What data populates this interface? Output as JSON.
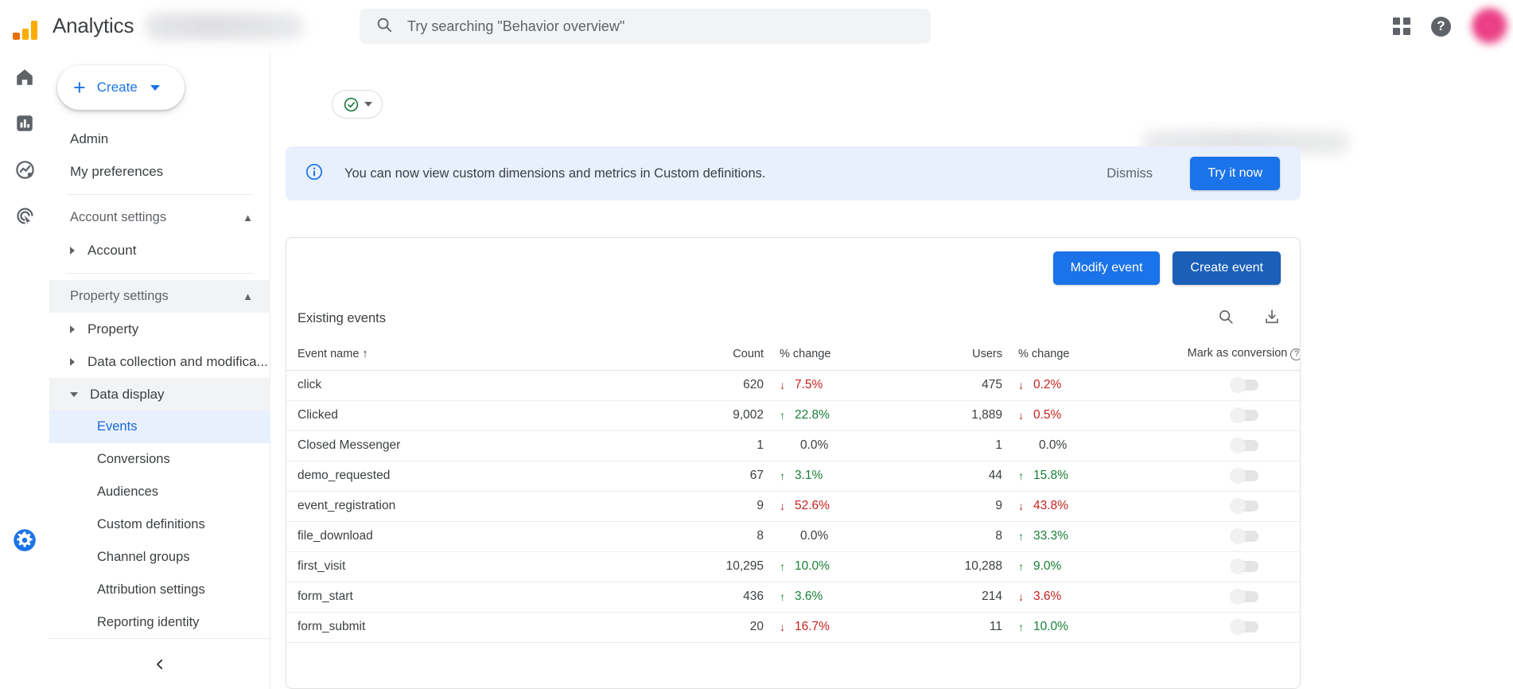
{
  "topbar": {
    "brand": "Analytics",
    "property_redacted": true,
    "search": {
      "placeholder": "Try searching \"Behavior overview\"",
      "value": "",
      "icon": "search-icon"
    },
    "apps_icon": "apps-grid-icon",
    "help_icon": "help-circle-icon",
    "avatar_icon": "user-avatar"
  },
  "rail": {
    "items": [
      {
        "icon": "home-icon",
        "name": "home"
      },
      {
        "icon": "reports-bar-chart-icon",
        "name": "reports"
      },
      {
        "icon": "explore-trend-icon",
        "name": "explore"
      },
      {
        "icon": "advertising-target-icon",
        "name": "advertising"
      }
    ],
    "settings_icon": "gear-icon"
  },
  "nav": {
    "create_label": "Create",
    "create_icon": "plus-icon",
    "create_caret": "chevron-down-icon",
    "items": [
      {
        "label": "Admin",
        "type": "link"
      },
      {
        "label": "My preferences",
        "type": "link"
      },
      {
        "label": "Account settings",
        "type": "group",
        "collapse_icon": "chevron-up-icon"
      },
      {
        "label": "Account",
        "type": "expandable",
        "expand_icon": "triangle-right-icon"
      },
      {
        "label": "Property settings",
        "type": "group",
        "collapse_icon": "chevron-up-icon"
      },
      {
        "label": "Property",
        "type": "expandable",
        "expand_icon": "triangle-right-icon"
      },
      {
        "label": "Data collection and modifica...",
        "type": "expandable",
        "expand_icon": "triangle-right-icon"
      },
      {
        "label": "Data display",
        "type": "expandable-open",
        "expand_icon": "triangle-down-icon"
      },
      {
        "label": "Events",
        "type": "sub",
        "selected": true
      },
      {
        "label": "Conversions",
        "type": "sub",
        "selected": false
      },
      {
        "label": "Audiences",
        "type": "sub",
        "selected": false
      },
      {
        "label": "Custom definitions",
        "type": "sub",
        "selected": false
      },
      {
        "label": "Channel groups",
        "type": "sub",
        "selected": false
      },
      {
        "label": "Attribution settings",
        "type": "sub",
        "selected": false
      },
      {
        "label": "Reporting identity",
        "type": "sub",
        "selected": false
      }
    ],
    "collapse_icon": "chevron-left-icon"
  },
  "main": {
    "status_chip": {
      "icon": "check-circle-icon",
      "caret": "chevron-down-icon",
      "color": "#137333"
    },
    "title_redacted": true,
    "banner": {
      "icon": "info-circle-icon",
      "text": "You can now view custom dimensions and metrics in Custom definitions.",
      "dismiss_label": "Dismiss",
      "cta_label": "Try it now",
      "bg": "#e8f0fe",
      "cta_color": "#1a73e8"
    },
    "actions": {
      "modify_label": "Modify event",
      "create_label": "Create event",
      "modify_color": "#1a73e8",
      "create_color": "#1b5fb8"
    },
    "table": {
      "title": "Existing events",
      "search_icon": "search-icon",
      "download_icon": "download-icon",
      "columns": [
        {
          "label": "Event name",
          "sort_icon": "arrow-up-icon"
        },
        {
          "label": "Count"
        },
        {
          "label": "% change"
        },
        {
          "label": "Users"
        },
        {
          "label": "% change"
        },
        {
          "label": "Mark as conversion",
          "help_icon": "help-circle-small-icon"
        }
      ],
      "rows": [
        {
          "event": "click",
          "count": "620",
          "count_dir": "down",
          "count_pct": "7.5%",
          "users": "475",
          "users_dir": "down",
          "users_pct": "0.2%",
          "conversion": false
        },
        {
          "event": "Clicked",
          "count": "9,002",
          "count_dir": "up",
          "count_pct": "22.8%",
          "users": "1,889",
          "users_dir": "down",
          "users_pct": "0.5%",
          "conversion": false
        },
        {
          "event": "Closed Messenger",
          "count": "1",
          "count_dir": "flat",
          "count_pct": "0.0%",
          "users": "1",
          "users_dir": "flat",
          "users_pct": "0.0%",
          "conversion": false
        },
        {
          "event": "demo_requested",
          "count": "67",
          "count_dir": "up",
          "count_pct": "3.1%",
          "users": "44",
          "users_dir": "up",
          "users_pct": "15.8%",
          "conversion": false
        },
        {
          "event": "event_registration",
          "count": "9",
          "count_dir": "down",
          "count_pct": "52.6%",
          "users": "9",
          "users_dir": "down",
          "users_pct": "43.8%",
          "conversion": false
        },
        {
          "event": "file_download",
          "count": "8",
          "count_dir": "flat",
          "count_pct": "0.0%",
          "users": "8",
          "users_dir": "up",
          "users_pct": "33.3%",
          "conversion": false
        },
        {
          "event": "first_visit",
          "count": "10,295",
          "count_dir": "up",
          "count_pct": "10.0%",
          "users": "10,288",
          "users_dir": "up",
          "users_pct": "9.0%",
          "conversion": false
        },
        {
          "event": "form_start",
          "count": "436",
          "count_dir": "up",
          "count_pct": "3.6%",
          "users": "214",
          "users_dir": "down",
          "users_pct": "3.6%",
          "conversion": false
        },
        {
          "event": "form_submit",
          "count": "20",
          "count_dir": "down",
          "count_pct": "16.7%",
          "users": "11",
          "users_dir": "up",
          "users_pct": "10.0%",
          "conversion": false
        }
      ]
    }
  }
}
